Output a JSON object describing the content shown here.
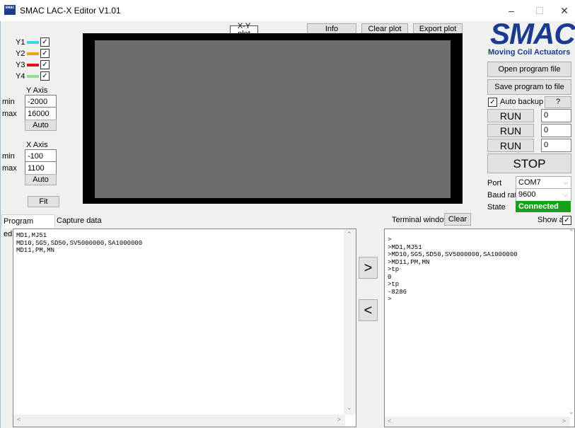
{
  "window": {
    "title": "SMAC LAC-X Editor V1.01",
    "icon_text": "SMAC",
    "minimize": "–",
    "maximize": "☐",
    "close": "✕"
  },
  "plot": {
    "title": "X-Y plot",
    "info": "Info",
    "clear": "Clear plot",
    "export": "Export plot"
  },
  "channels": [
    {
      "label": "Y1",
      "color": "#3fd3f0",
      "checked": "✓"
    },
    {
      "label": "Y2",
      "color": "#f5a01a",
      "checked": "✓"
    },
    {
      "label": "Y3",
      "color": "#e0101a",
      "checked": "✓"
    },
    {
      "label": "Y4",
      "color": "#8de08d",
      "checked": "✓"
    }
  ],
  "y_axis": {
    "title": "Y Axis",
    "min_label": "min",
    "min": "-2000",
    "max_label": "max",
    "max": "16000",
    "auto": "Auto"
  },
  "x_axis": {
    "title": "X Axis",
    "min_label": "min",
    "min": "-100",
    "max_label": "max",
    "max": "1100",
    "auto": "Auto"
  },
  "fit": "Fit",
  "logo": {
    "name": "SMAC",
    "tagline": "Moving Coil Actuators"
  },
  "file": {
    "open": "Open program file",
    "save": "Save program to file"
  },
  "backup": {
    "label": "Auto backup",
    "checked": "✓",
    "help": "?"
  },
  "run": [
    {
      "label": "RUN",
      "value": "0"
    },
    {
      "label": "RUN",
      "value": "0"
    },
    {
      "label": "RUN",
      "value": "0"
    }
  ],
  "stop": "STOP",
  "connection": {
    "port_label": "Port",
    "port": "COM7",
    "baud_label": "Baud rate",
    "baud": "9600",
    "state_label": "State",
    "state": "Connected",
    "state_color": "#17a11a"
  },
  "tabs": {
    "editor": "Program editor",
    "capture": "Capture data"
  },
  "terminal": {
    "label": "Terminal window",
    "clear": "Clear",
    "show_all": "Show all",
    "show_all_checked": "✓"
  },
  "editor_lines": [
    "MD1,MJ51",
    "MD10,SG5,SD50,SV5000000,SA1000000",
    "MD11,PM,MN"
  ],
  "terminal_lines": [
    ">",
    ">MD1,MJ51",
    ">MD10,SG5,SD50,SV5000000,SA1000000",
    ">MD11,PM,MN",
    ">tp",
    "0",
    ">tp",
    "-8286",
    ">"
  ],
  "send": {
    "right": ">",
    "left": "<"
  }
}
